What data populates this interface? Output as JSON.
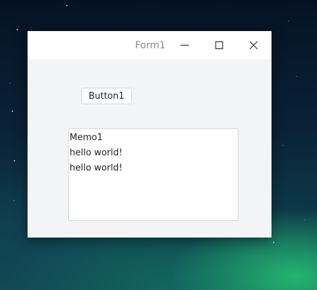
{
  "window": {
    "title": "Form1",
    "controls": {
      "minimize_icon": "minimize-icon",
      "maximize_icon": "maximize-icon",
      "close_icon": "close-icon"
    }
  },
  "form": {
    "button1_label": "Button1",
    "memo": {
      "lines": [
        "Memo1",
        "hello world!",
        "hello world!"
      ]
    }
  },
  "colors": {
    "form_background": "#f3f4f6",
    "titlebar": "#ffffff",
    "title_text": "#8a8a8a"
  }
}
